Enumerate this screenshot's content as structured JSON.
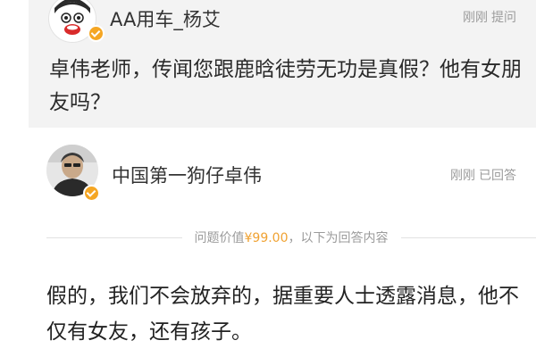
{
  "question": {
    "avatar_icon": "cartoon-face-avatar",
    "asker_name": "AA用车_杨艾",
    "time": "刚刚",
    "action": "提问",
    "text": "卓伟老师，传闻您跟鹿晗徒劳无功是真假？他有女朋友吗？"
  },
  "answer": {
    "avatar_icon": "person-photo-avatar",
    "answerer_name": "中国第一狗仔卓伟",
    "time": "刚刚",
    "status": "已回答",
    "verified_badge_color": "#f5a623",
    "divider": {
      "prefix": "问题价值",
      "price": "¥99.00",
      "suffix": "，以下为回答内容"
    },
    "text": "假的，我们不会放弃的，据重要人士透露消息，他不仅有女友，还有孩子。"
  }
}
